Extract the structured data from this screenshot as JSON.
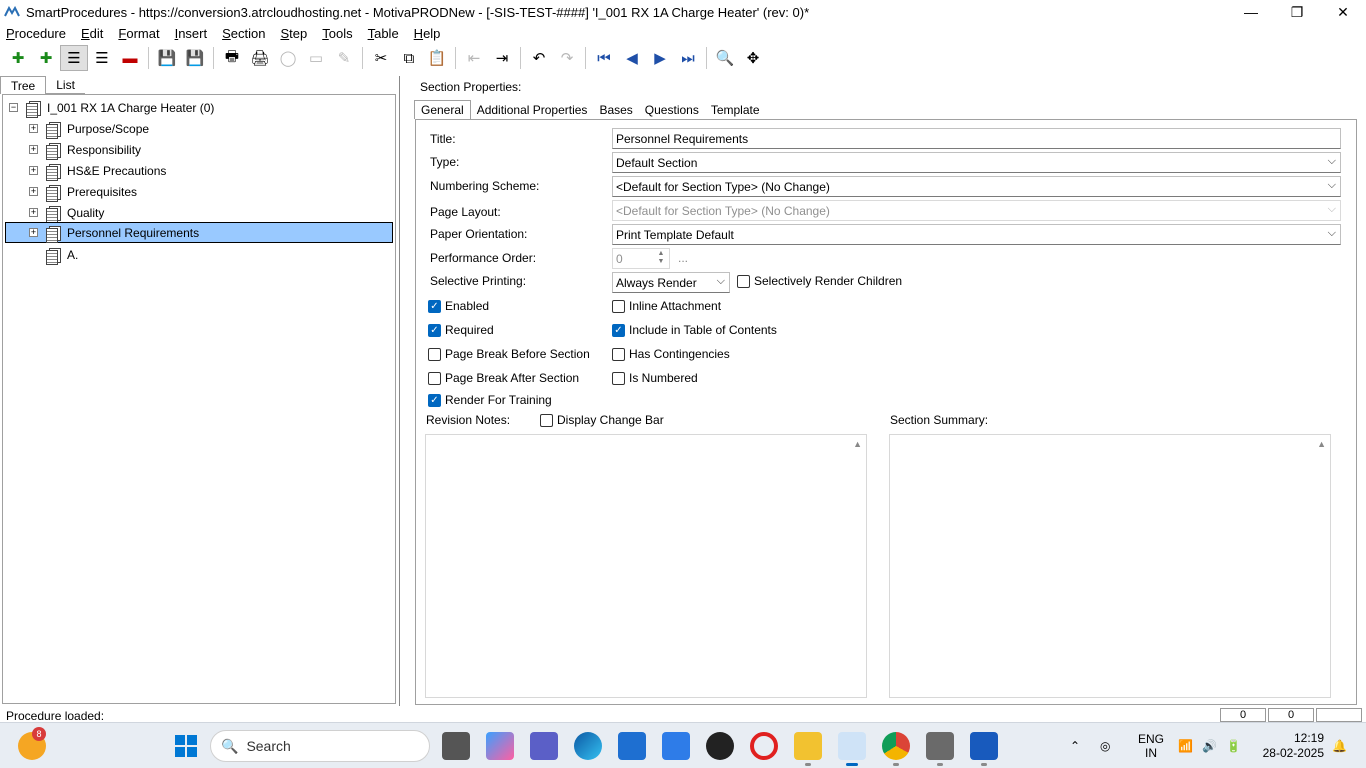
{
  "window": {
    "title": "SmartProcedures - https://conversion3.atrcloudhosting.net - MotivaPRODNew - [-SIS-TEST-####] 'I_001 RX 1A Charge Heater' (rev: 0)*",
    "minimize_glyph": "—",
    "maximize_glyph": "❐",
    "close_glyph": "✕"
  },
  "menu": [
    {
      "u": "P",
      "rest": "rocedure"
    },
    {
      "u": "E",
      "rest": "dit"
    },
    {
      "u": "F",
      "rest": "ormat"
    },
    {
      "u": "I",
      "rest": "nsert"
    },
    {
      "u": "S",
      "rest": "ection"
    },
    {
      "u": "S",
      "rest": "tep"
    },
    {
      "u": "T",
      "rest": "ools"
    },
    {
      "u": "T",
      "rest": "able"
    },
    {
      "u": "H",
      "rest": "elp"
    }
  ],
  "toolbar_icons": {
    "add": "✚",
    "add_child": "✚",
    "outline": "☰",
    "outline2": "☰",
    "remove": "▬",
    "save_all": "💾",
    "save": "💾",
    "print_preview": "🖶",
    "print": "🖨",
    "refresh": "◯",
    "template": "▭",
    "wand": "✎",
    "cut": "✂",
    "copy": "⧉",
    "paste": "📋",
    "outdent": "⇤",
    "indent": "⇥",
    "undo": "↶",
    "redo": "↷",
    "first": "⏮",
    "prev": "◀",
    "next": "▶",
    "last": "⏭",
    "find": "🔍",
    "move": "✥"
  },
  "left": {
    "tabs": [
      "Tree",
      "List"
    ],
    "root": "I_001 RX 1A Charge Heater (0)",
    "items": [
      "Purpose/Scope",
      "Responsibility",
      "HS&E Precautions",
      "Prerequisites",
      "Quality",
      "Personnel Requirements"
    ],
    "child": "A."
  },
  "right": {
    "section_label": "Section Properties:",
    "tabs": [
      "General",
      "Additional Properties",
      "Bases",
      "Questions",
      "Template"
    ],
    "labels": {
      "title": "Title:",
      "type": "Type:",
      "numbering": "Numbering Scheme:",
      "layout": "Page Layout:",
      "orientation": "Paper Orientation:",
      "perf_order": "Performance Order:",
      "selective": "Selective Printing:",
      "revision_notes": "Revision Notes:",
      "section_summary": "Section Summary:"
    },
    "values": {
      "title": "Personnel Requirements",
      "type": "Default Section",
      "numbering": "<Default for Section Type> (No Change)",
      "layout": "<Default for Section Type> (No Change)",
      "orientation": "Print Template Default",
      "perf_order": "0",
      "selective": "Always Render",
      "ellipsis": "..."
    },
    "checks": {
      "selectively_render_children": "Selectively Render Children",
      "enabled": "Enabled",
      "inline_attachment": "Inline Attachment",
      "required": "Required",
      "include_toc": "Include in Table of Contents",
      "page_break_before": "Page Break Before Section",
      "has_contingencies": "Has Contingencies",
      "page_break_after": "Page Break After Section",
      "is_numbered": "Is Numbered",
      "render_training": "Render For Training",
      "display_change_bar": "Display Change Bar"
    },
    "check_mark": "✓",
    "caret": "⌵",
    "scroll_up": "▲"
  },
  "status": {
    "text": "Procedure loaded:",
    "cell1": "0",
    "cell2": "0"
  },
  "taskbar": {
    "search": "Search",
    "weather_badge": "8",
    "lang1": "ENG",
    "lang2": "IN",
    "time": "12:19",
    "date": "28-02-2025",
    "search_icon": "🔍",
    "chevron_up": "⌃",
    "wifi": "📶",
    "volume": "🔊",
    "battery": "🔋",
    "bell": "🔔"
  },
  "colors": {
    "selection": "#99c9ff",
    "checkbox": "#0067c0"
  }
}
